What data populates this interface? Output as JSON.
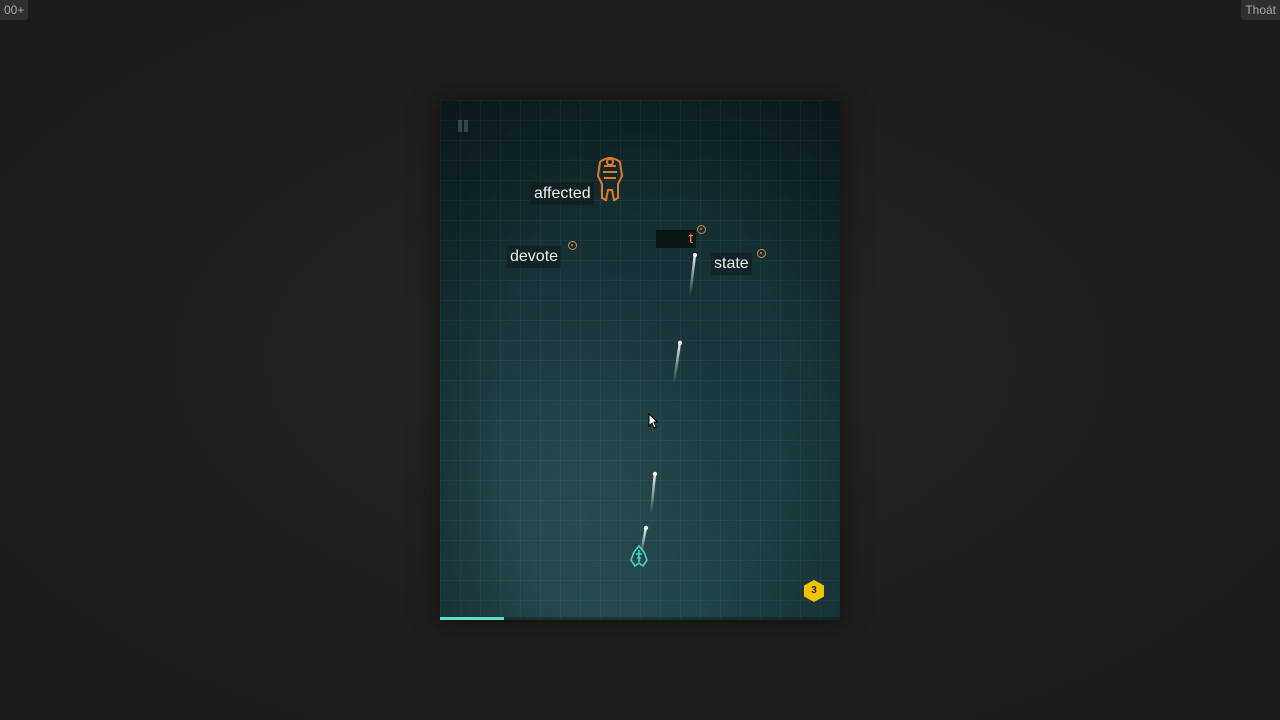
{
  "top_bar": {
    "counter_text": "00+",
    "exit_label": "Thoát"
  },
  "game": {
    "words": [
      {
        "id": "affected",
        "text": "affected"
      },
      {
        "id": "devote",
        "text": "devote"
      },
      {
        "id": "state",
        "text": "state"
      }
    ],
    "active_word": {
      "typed_text": "t"
    },
    "level_number": "3",
    "progress_fraction": 0.16,
    "colors": {
      "typed_letter": "#ff7a2a",
      "enemy": "#e07a28",
      "player_ship": "#3fd8c8",
      "level_badge": "#f2c300",
      "progress": "#5fe0c8"
    },
    "icons": [
      "pause-icon",
      "enemy-mothership-icon",
      "player-ship-icon",
      "level-hexagon-icon",
      "mouse-cursor-icon"
    ]
  }
}
